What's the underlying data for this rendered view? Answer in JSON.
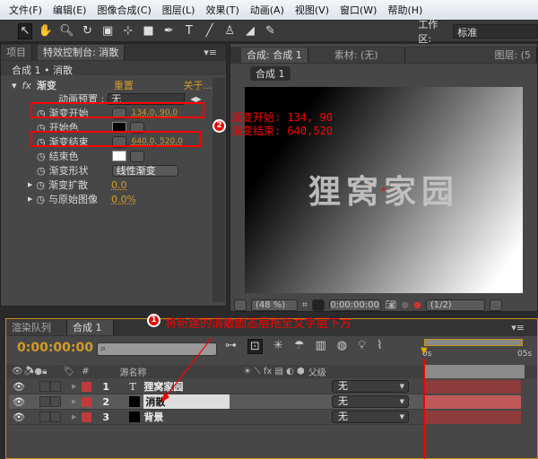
{
  "menu": [
    "文件(F)",
    "编辑(E)",
    "图像合成(C)",
    "图层(L)",
    "效果(T)",
    "动画(A)",
    "视图(V)",
    "窗口(W)",
    "帮助(H)"
  ],
  "toolbar": {
    "workspace_label": "工作区:",
    "workspace_value": "标准",
    "tools": [
      "selection-tool",
      "hand-tool",
      "zoom-tool",
      "rotate-tool",
      "camera-tool",
      "pan-behind-tool",
      "rectangle-tool",
      "pen-tool",
      "text-tool",
      "brush-tool",
      "clone-stamp-tool",
      "eraser-tool",
      "puppet-tool"
    ]
  },
  "effect_panel": {
    "tabs": [
      "项目",
      "特效控制台: 消散"
    ],
    "header": "合成 1 • 消散",
    "effect_name": "渐变",
    "reset": "重置",
    "about": "关于...",
    "preset_label": "动画预置 :",
    "preset_value": "无",
    "props": [
      {
        "label": "渐变开始",
        "value": "134.0, 90.0"
      },
      {
        "label": "开始色",
        "color": "#000000"
      },
      {
        "label": "渐变结束",
        "value": "640.0, 520.0"
      },
      {
        "label": "结束色",
        "color": "#ffffff"
      },
      {
        "label": "渐变形状",
        "value": "线性渐变"
      },
      {
        "label": "渐变扩散",
        "value": "0.0"
      },
      {
        "label": "与原始图像",
        "value": "0.0%"
      }
    ]
  },
  "viewer": {
    "tabs": [
      "合成: 合成 1",
      "素材: (无)",
      "图层: (5"
    ],
    "subtab": "合成 1",
    "canvas_text": "狸窝家园",
    "zoom": "(48 %)",
    "timecode": "0:00:00:00",
    "resolution": "(1/2)"
  },
  "annotations": {
    "badge1": "1",
    "note1": "将新建的消散固态层拖至文字层下方",
    "badge2": "2",
    "note2_line1": "渐变开始: 134, 90",
    "note2_line2": "渐变结束: 640,520",
    "color": "#ff0000"
  },
  "timeline": {
    "tabs": [
      "渲染队列",
      "合成 1"
    ],
    "timecode": "0:00:00:00",
    "search_placeholder": "",
    "col_num": "#",
    "col_name": "源名称",
    "col_parent": "父级",
    "ruler": [
      "0s",
      "05s"
    ],
    "layers": [
      {
        "num": "1",
        "type": "T",
        "name": "狸窝家园",
        "parent": "无"
      },
      {
        "num": "2",
        "type": "solid",
        "name": "消散",
        "parent": "无"
      },
      {
        "num": "3",
        "type": "solid",
        "name": "背景",
        "parent": "无"
      }
    ],
    "label_color": "#c03a3a"
  }
}
